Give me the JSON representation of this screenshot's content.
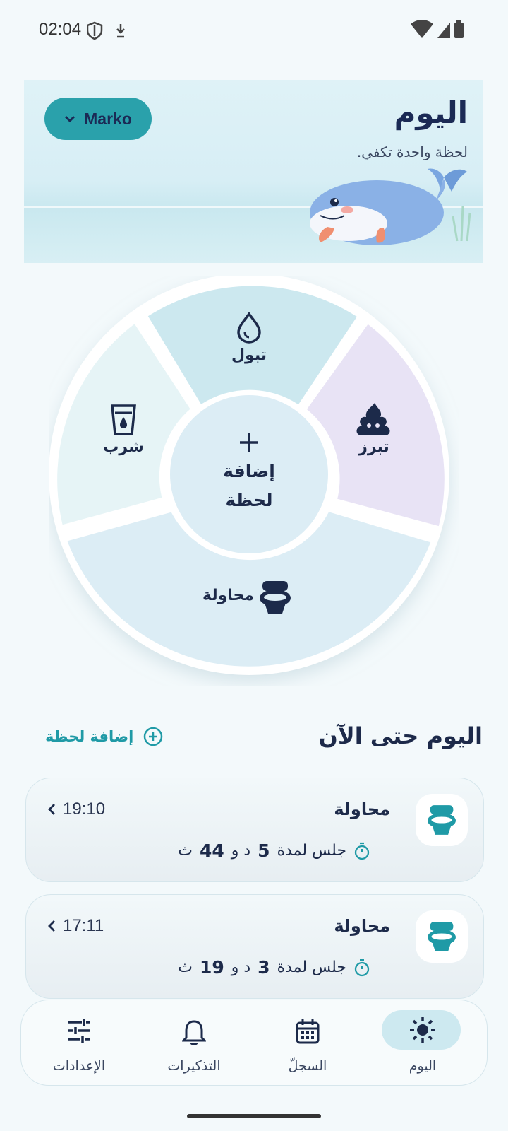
{
  "status_bar": {
    "time": "02:04"
  },
  "banner": {
    "title": "اليوم",
    "subtitle": "لحظة واحدة تكفي.",
    "profile_name": "Marko"
  },
  "wheel": {
    "center_line1": "إضافة",
    "center_line2": "لحظة",
    "segments": {
      "top": "تبول",
      "right": "تبرز",
      "bottom": "محاولة",
      "left": "شرب"
    }
  },
  "section": {
    "title": "اليوم حتى الآن",
    "add_label": "إضافة لحظة"
  },
  "entries": [
    {
      "title": "محاولة",
      "time": "19:10",
      "detail_prefix": "جلس لمدة",
      "minutes": "5",
      "minutes_unit": "د و",
      "seconds": "44",
      "seconds_unit": "ث"
    },
    {
      "title": "محاولة",
      "time": "17:11",
      "detail_prefix": "جلس لمدة",
      "minutes": "3",
      "minutes_unit": "د و",
      "seconds": "19",
      "seconds_unit": "ث"
    }
  ],
  "nav": {
    "today": "اليوم",
    "log": "السجلّ",
    "reminders": "التذكيرات",
    "settings": "الإعدادات"
  },
  "colors": {
    "accent": "#2aa1ab",
    "navy": "#1d2a4a",
    "teal_icon": "#1f9aa6"
  },
  "icons": {
    "top": "drop-icon",
    "right": "poop-icon",
    "bottom": "toilet-icon",
    "left": "cup-icon"
  }
}
